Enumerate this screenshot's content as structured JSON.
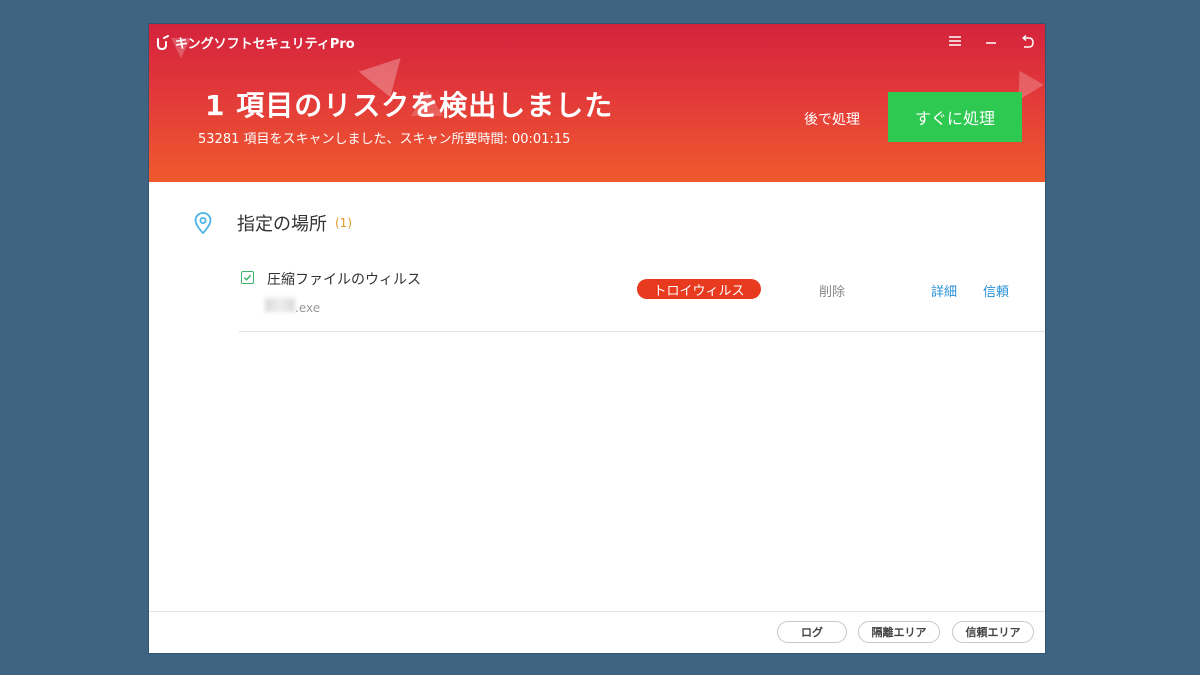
{
  "app": {
    "title": "キングソフトセキュリティPro",
    "window_controls": [
      "menu-icon",
      "minimize-icon",
      "back-icon"
    ]
  },
  "header": {
    "headline": "1 項目のリスクを検出しました",
    "scan_summary": "53281 項目をスキャンしました、スキャン所要時間: 00:01:15",
    "later_label": "後で処理",
    "now_label": "すぐに処理"
  },
  "section": {
    "title": "指定の場所",
    "count": "(1)"
  },
  "threats": [
    {
      "name": "圧縮ファイルのウィルス",
      "file": ".exe",
      "type": "トロイウィルス",
      "action": "削除",
      "details_label": "詳細",
      "trust_label": "信頼",
      "checked": true
    }
  ],
  "footer": {
    "log_label": "ログ",
    "quarantine_label": "隔離エリア",
    "trusted_label": "信頼エリア"
  },
  "colors": {
    "header_top": "#d4233c",
    "header_bottom": "#ef5a2d",
    "primary_button": "#2dc950",
    "badge": "#e83a1e",
    "link": "#2a8fd8",
    "check": "#3bb36a",
    "pin": "#4ab4e6"
  }
}
